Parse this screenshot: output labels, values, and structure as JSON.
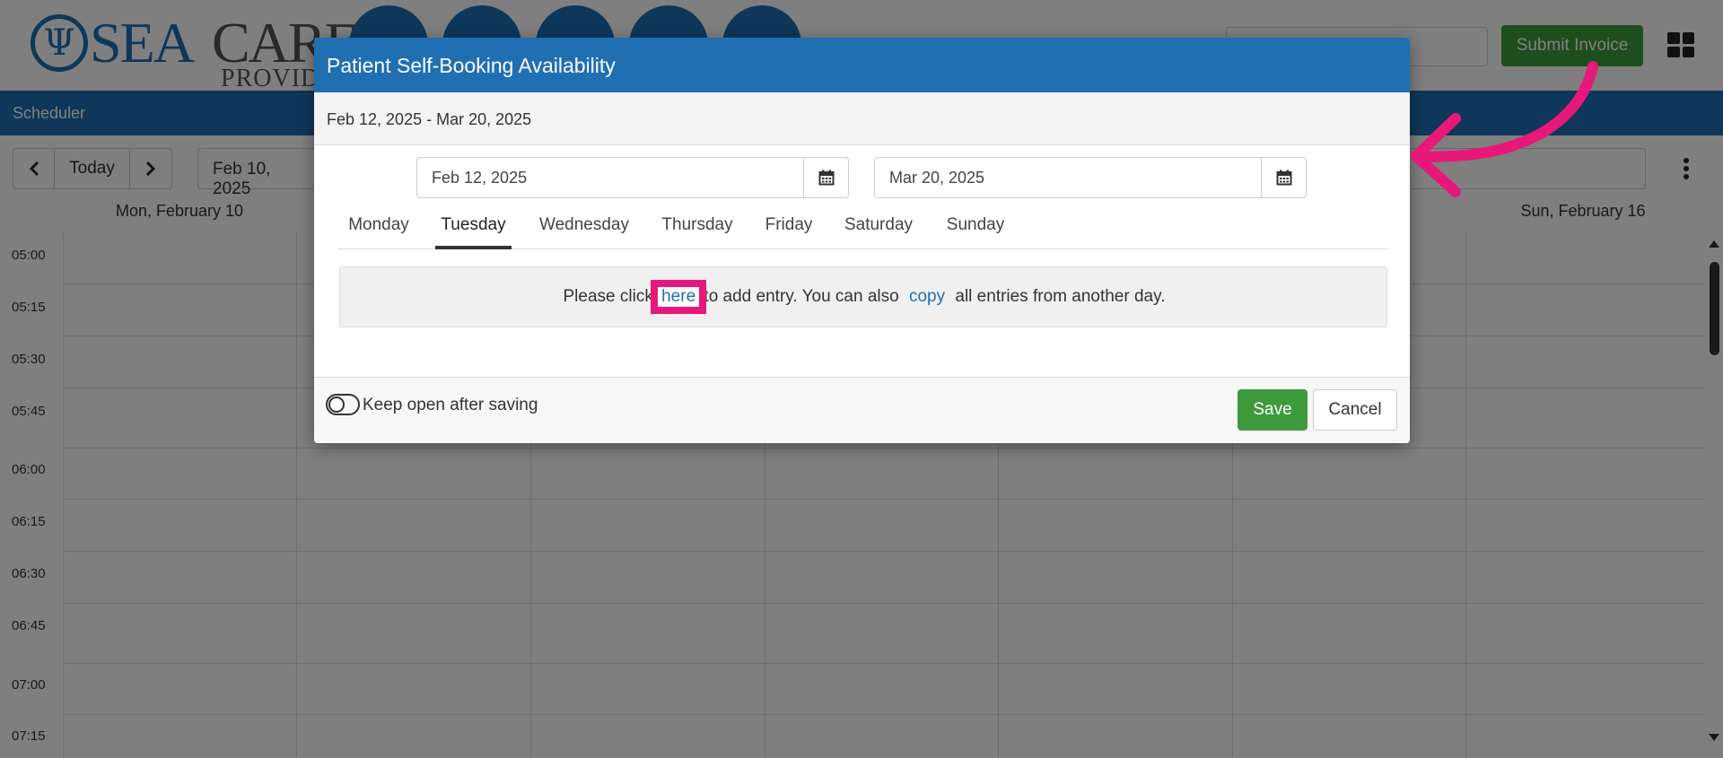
{
  "app": {
    "logo": {
      "part1": "SEA",
      "part2": "CARE",
      "sub": "PROVIDER"
    },
    "header": {
      "submit_invoice": "Submit Invoice"
    },
    "scheduler": {
      "title": "Scheduler"
    },
    "toolbar": {
      "today": "Today",
      "date": "Feb 10, 2025"
    },
    "calendar": {
      "days": [
        "Mon, February 10",
        "Sun, February 16"
      ],
      "times": [
        "05:00",
        "05:15",
        "05:30",
        "05:45",
        "06:00",
        "06:15",
        "06:30",
        "06:45",
        "07:00",
        "07:15"
      ]
    }
  },
  "modal": {
    "title": "Patient Self-Booking Availability",
    "range": "Feb 12, 2025 - Mar 20, 2025",
    "start_date": "Feb 12, 2025",
    "end_date": "Mar 20, 2025",
    "tabs": [
      {
        "label": "Monday"
      },
      {
        "label": "Tuesday"
      },
      {
        "label": "Wednesday"
      },
      {
        "label": "Thursday"
      },
      {
        "label": "Friday"
      },
      {
        "label": "Saturday"
      },
      {
        "label": "Sunday"
      }
    ],
    "active_tab": "Tuesday",
    "info": {
      "prefix": "Please click",
      "here": "here",
      "middle": "to add entry. You can also",
      "copy": "copy",
      "suffix": "all entries from another day."
    },
    "keep_open": "Keep open after saving",
    "save": "Save",
    "cancel": "Cancel"
  },
  "colors": {
    "primary": "#1f6fb2",
    "success": "#3d9b3d",
    "highlight": "#e8187a"
  }
}
